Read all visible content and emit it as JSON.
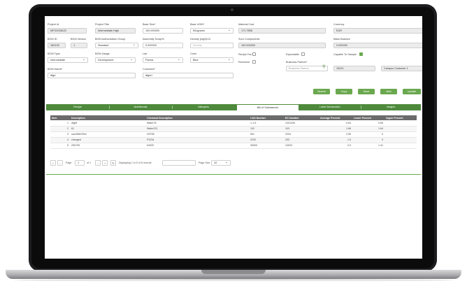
{
  "form": {
    "project_id": {
      "label": "Project Id",
      "value": "MFG2008122"
    },
    "project_title": {
      "label": "Project Title",
      "value": "Intermediate High"
    },
    "base_size": {
      "label": "Base Size*",
      "value": "100.000000"
    },
    "base_uom": {
      "label": "Base UOM*",
      "value": "Kilograms"
    },
    "material_cost": {
      "label": "Material Cost",
      "value": "171.7858"
    },
    "currency": {
      "label": "Currency",
      "value": "EUR"
    },
    "bom_id": {
      "label": "BOM ID",
      "value": "16013X"
    },
    "bom_version": {
      "label": "BOM Version",
      "value": "1"
    },
    "bom_auth_group": {
      "label": "BOM Authorization Group",
      "value": "Standard"
    },
    "assembly_scrap": {
      "label": "Assembly Scrap%",
      "value": "0.000000"
    },
    "density": {
      "label": "Density (mg/l)m3",
      "placeholder": "Density"
    },
    "sum_components": {
      "label": "Sum Components",
      "value": "100.000000"
    },
    "mass_balance": {
      "label": "Mass Balance",
      "value": "0.000000"
    },
    "bom_type": {
      "label": "BOM Type",
      "value": "Intermediate"
    },
    "bom_usage": {
      "label": "BOM Usage",
      "value": "Development"
    },
    "lab": {
      "label": "Lab",
      "value": "Parma"
    },
    "color": {
      "label": "Color",
      "value": "Blue"
    },
    "recipe_fav": {
      "label": "Recipe Fav"
    },
    "explodable": {
      "label": "Explodable"
    },
    "capable_to_sample": {
      "label": "Capable To Sample"
    },
    "received": {
      "label": "Received"
    },
    "business_partner": {
      "label": "Business Partner*",
      "placeholder": "Business Partner",
      "code": "10021",
      "name": "Campus Customer 1"
    },
    "bom_name": {
      "label": "BOM Name*",
      "value": "dfgd"
    },
    "comment": {
      "label": "Comment*",
      "value": "dfgert"
    }
  },
  "actions": [
    "Search",
    "Copy",
    "Save",
    "New",
    "Update"
  ],
  "tabs": [
    "Recipe",
    "Nutritionals",
    "Allergens",
    "Bill of Substances",
    "Label Declaration",
    "Images"
  ],
  "table": {
    "headers": [
      "Item",
      "Description",
      "Chemical Description",
      "CAS Number",
      "EC Number",
      "Average Percent",
      "Lower Percent",
      "Upper Percent"
    ],
    "rows": [
      [
        "1",
        "dfgdf",
        "Water78",
        "1-1-5",
        "1201205",
        "0.64",
        "0.65",
        ""
      ],
      [
        "2",
        "61",
        "Water221",
        "102",
        "103",
        "1.66",
        "1.64",
        ""
      ],
      [
        "3",
        "cac45847816",
        "H2755",
        "501",
        "2234",
        "2.55",
        "0",
        ""
      ],
      [
        "4",
        "changed",
        "P1234",
        "2220",
        "203",
        "1.9",
        "0",
        ""
      ],
      [
        "5",
        "200705",
        "h2020",
        "30000",
        "12023",
        "2.0",
        "1.41",
        ""
      ]
    ]
  },
  "pager": {
    "page_label": "Page",
    "page": "1",
    "of": "of 1",
    "display": "Displaying 1 to 5 of 5 records",
    "size_label": "Page Size",
    "size": "10"
  }
}
